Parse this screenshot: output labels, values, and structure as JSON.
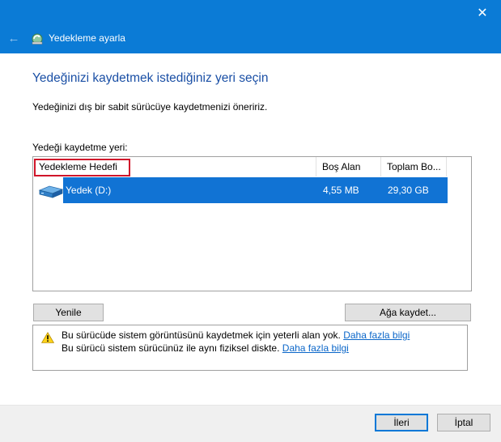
{
  "window": {
    "title": "Yedekleme ayarla",
    "back_icon": "←",
    "close_icon": "✕"
  },
  "main": {
    "heading": "Yedeğinizi kaydetmek istediğiniz yeri seçin",
    "description": "Yedeğinizi dış bir sabit sürücüye kaydetmenizi öneririz.",
    "list_label": "Yedeği kaydetme yeri:"
  },
  "list": {
    "columns": [
      "Yedekleme Hedefi",
      "Boş Alan",
      "Toplam Bo..."
    ],
    "rows": [
      {
        "name": "Yedek (D:)",
        "free": "4,55 MB",
        "total": "29,30 GB",
        "selected": true,
        "icon": "drive-icon"
      }
    ]
  },
  "buttons": {
    "refresh": "Yenile",
    "network_save": "Ağa kaydet...",
    "next": "İleri",
    "cancel": "İptal"
  },
  "warnings": [
    {
      "text": "Bu sürücüde sistem görüntüsünü kaydetmek için yeterli alan yok. ",
      "link": "Daha fazla bilgi"
    },
    {
      "text": "Bu sürücü sistem sürücünüz ile aynı fiziksel diskte. ",
      "link": "Daha fazla bilgi"
    }
  ],
  "colors": {
    "titlebar": "#0b7bd6",
    "heading": "#1a4fa5",
    "selection": "#1173d4",
    "highlight_box": "#d0152a",
    "link": "#0a66c9"
  }
}
